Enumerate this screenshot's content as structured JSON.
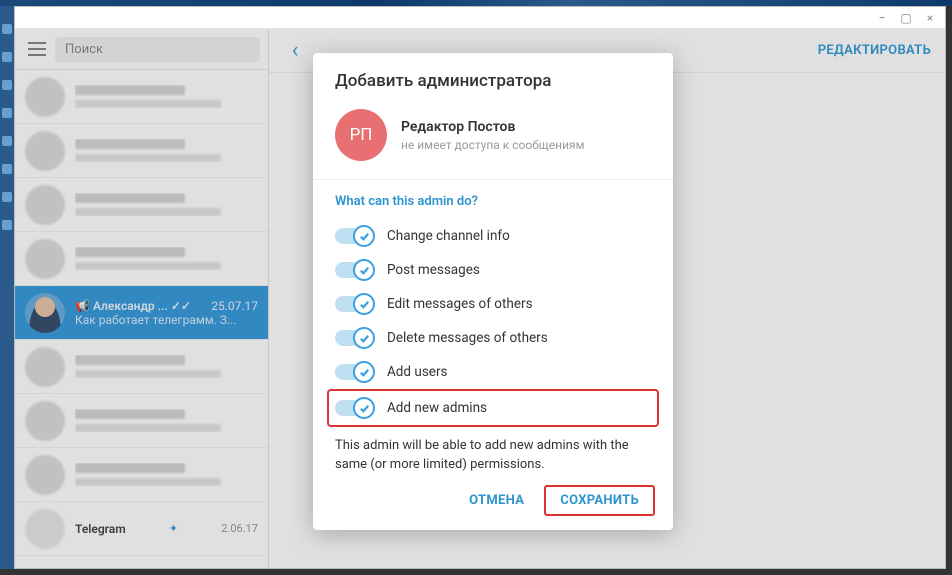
{
  "window_controls": {
    "min": "−",
    "max": "▢",
    "close": "×"
  },
  "sidebar": {
    "search_placeholder": "Поиск",
    "selected_chat": {
      "name": "Александр ...",
      "date": "25.07.17",
      "message": "Как работает телеграмм. З..."
    },
    "bottom_chat": {
      "name": "Telegram",
      "date": "2.06.17"
    }
  },
  "main_header": {
    "edit_label": "РЕДАКТИРОВАТЬ"
  },
  "modal": {
    "title": "Добавить администратора",
    "admin": {
      "initials": "РП",
      "name": "Редактор Постов",
      "subtitle": "не имеет доступа к сообщениям"
    },
    "section_label": "What can this admin do?",
    "permissions": [
      {
        "label": "Change channel info",
        "on": true
      },
      {
        "label": "Post messages",
        "on": true
      },
      {
        "label": "Edit messages of others",
        "on": true
      },
      {
        "label": "Delete messages of others",
        "on": true
      },
      {
        "label": "Add users",
        "on": true
      },
      {
        "label": "Add new admins",
        "on": true,
        "highlight": true
      }
    ],
    "note": "This admin will be able to add new admins with the same (or more limited) permissions.",
    "cancel_label": "ОТМЕНА",
    "save_label": "СОХРАНИТЬ"
  }
}
